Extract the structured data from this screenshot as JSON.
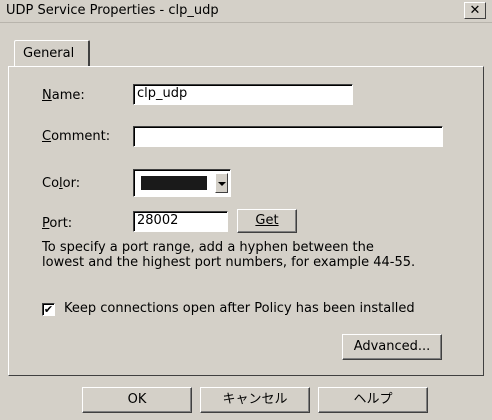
{
  "window": {
    "title": "UDP Service Properties - clp_udp",
    "close_glyph": "✕"
  },
  "tabs": [
    {
      "label": "General",
      "selected": true
    }
  ],
  "form": {
    "name": {
      "label": "Name:",
      "value": "clp_udp"
    },
    "comment": {
      "label": "Comment:",
      "value": ""
    },
    "color": {
      "label": "Color:",
      "value": "#1a1a1a"
    },
    "port": {
      "label": "Port:",
      "value": "28002"
    },
    "get_button": "Get",
    "help_line1": "To specify a port range, add a hyphen between the",
    "help_line2": "lowest and the highest port numbers, for example 44-55.",
    "keep_connections": {
      "label": "Keep connections open after Policy has been installed",
      "checked": true,
      "check_glyph": "✔"
    },
    "advanced_button": "Advanced..."
  },
  "footer": {
    "ok": "OK",
    "cancel": "キャンセル",
    "help": "ヘルプ"
  },
  "icons": {
    "close": "close-icon",
    "dropdown": "chevron-down-icon",
    "check": "check-icon"
  }
}
